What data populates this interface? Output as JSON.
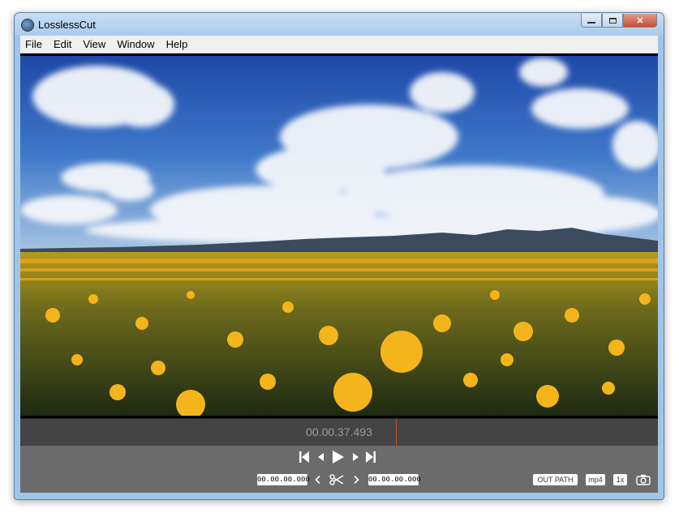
{
  "window": {
    "title": "LosslessCut",
    "close_glyph": "✕"
  },
  "menu": {
    "items": [
      "File",
      "Edit",
      "View",
      "Window",
      "Help"
    ]
  },
  "player": {
    "current_time": "00.00.37.493",
    "progress": 0.589
  },
  "controls": {
    "cut_start": "00.00.00.000",
    "cut_end": "00.00.00.000",
    "out_path_label": "OUT PATH",
    "format_label": "mp4",
    "speed_label": "1x"
  },
  "icons": {
    "app": "lossless-cut-icon",
    "jump_start": "skip-to-start-icon",
    "prev_frame": "step-back-icon",
    "play": "play-icon",
    "next_frame": "step-forward-icon",
    "jump_end": "skip-to-end-icon",
    "scissors": "scissors-icon",
    "camera": "camera-icon"
  }
}
